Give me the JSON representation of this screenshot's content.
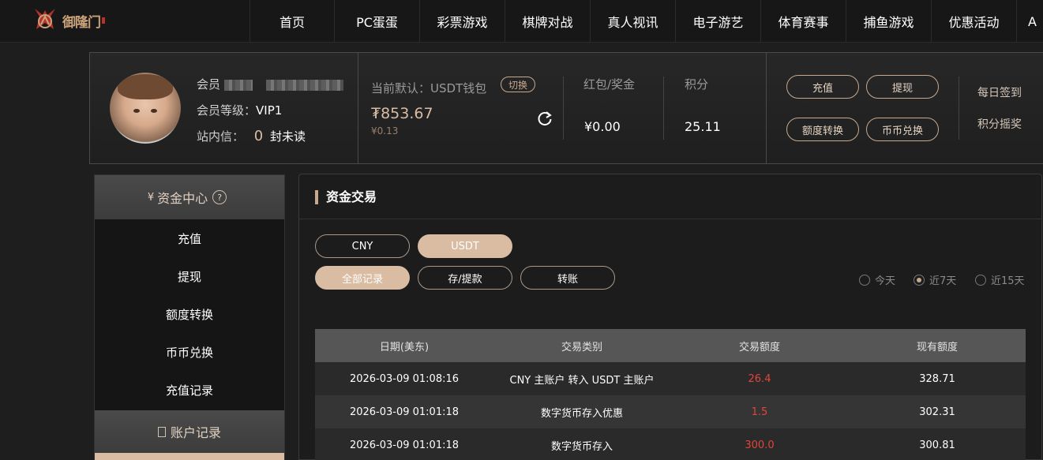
{
  "nav": {
    "logo_text": "御隆门",
    "items": [
      "首页",
      "PC蛋蛋",
      "彩票游戏",
      "棋牌对战",
      "真人视讯",
      "电子游艺",
      "体育赛事",
      "捕鱼游戏",
      "优惠活动",
      "A"
    ]
  },
  "profile": {
    "member_label": "会员",
    "level_label": "会员等级：",
    "level_value": "VIP1",
    "inbox_label": "站内信：",
    "inbox_count": "0",
    "inbox_suffix": "封未读",
    "wallet_label": "当前默认：USDT钱包",
    "switch_label": "切换",
    "balance": "₮853.67",
    "balance_sub": "¥0.13",
    "redpacket_label": "红包/奖金",
    "redpacket_value": "¥0.00",
    "points_label": "积分",
    "points_value": "25.11",
    "buttons": {
      "deposit": "充值",
      "withdraw": "提现",
      "transfer": "额度转换",
      "exchange": "币币兑换"
    },
    "daily_signin": "每日签到",
    "points_lottery": "积分摇奖"
  },
  "sidebar": {
    "fund_center": "资金中心",
    "items": [
      "充值",
      "提现",
      "额度转换",
      "币币兑换",
      "充值记录"
    ],
    "account_records": "账户记录"
  },
  "panel": {
    "title": "资金交易",
    "currency_tabs": [
      "CNY",
      "USDT"
    ],
    "type_tabs": [
      "全部记录",
      "存/提款",
      "转账"
    ],
    "range_options": [
      "今天",
      "近7天",
      "近15天"
    ],
    "table": {
      "headers": [
        "日期(美东)",
        "交易类别",
        "交易额度",
        "现有额度"
      ],
      "rows": [
        [
          "2026-03-09 01:08:16",
          "CNY 主账户 转入 USDT 主账户",
          "26.4",
          "328.71"
        ],
        [
          "2026-03-09 01:01:18",
          "数字货币存入优惠",
          "1.5",
          "302.31"
        ],
        [
          "2026-03-09 01:01:18",
          "数字货币存入",
          "300.0",
          "300.81"
        ]
      ]
    }
  }
}
